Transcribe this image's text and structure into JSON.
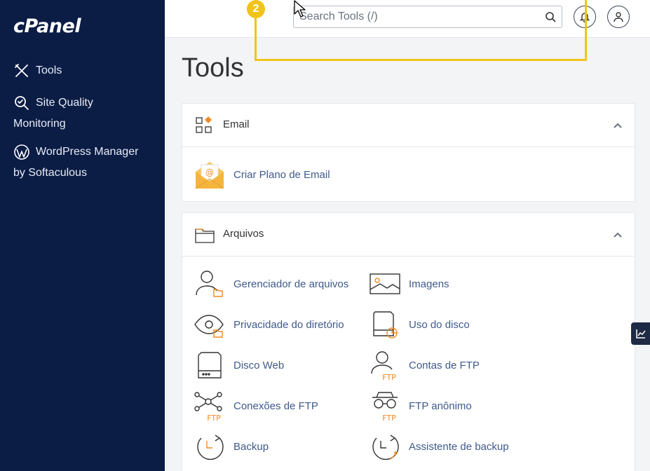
{
  "brand": {
    "logo": "cPanel"
  },
  "sidebar": {
    "items": [
      {
        "label": "Tools",
        "icon": "tools-icon"
      },
      {
        "label": "Site Quality",
        "label2": "Monitoring",
        "icon": "site-quality-icon"
      },
      {
        "label": "WordPress Manager",
        "label2": "by Softaculous",
        "icon": "wordpress-icon"
      }
    ]
  },
  "header": {
    "search_placeholder": "Search Tools (/)",
    "annotation_number": "2"
  },
  "main": {
    "title": "Tools",
    "sections": [
      {
        "title": "Email",
        "tools": [
          {
            "label": "Criar Plano de Email"
          }
        ]
      },
      {
        "title": "Arquivos",
        "tools": [
          {
            "label": "Gerenciador de arquivos"
          },
          {
            "label": "Imagens"
          },
          {
            "label": "Privacidade do diretório"
          },
          {
            "label": "Uso do disco"
          },
          {
            "label": "Disco Web"
          },
          {
            "label": "Contas de FTP"
          },
          {
            "label": "Conexões de FTP"
          },
          {
            "label": "FTP anônimo"
          },
          {
            "label": "Backup"
          },
          {
            "label": "Assistente de backup"
          }
        ]
      }
    ]
  },
  "icon_text": {
    "ftp": "FTP"
  },
  "colors": {
    "sidebar": "#0b1c45",
    "accent": "#f08a24",
    "link": "#3f5a8a",
    "highlight": "#f0c419"
  }
}
